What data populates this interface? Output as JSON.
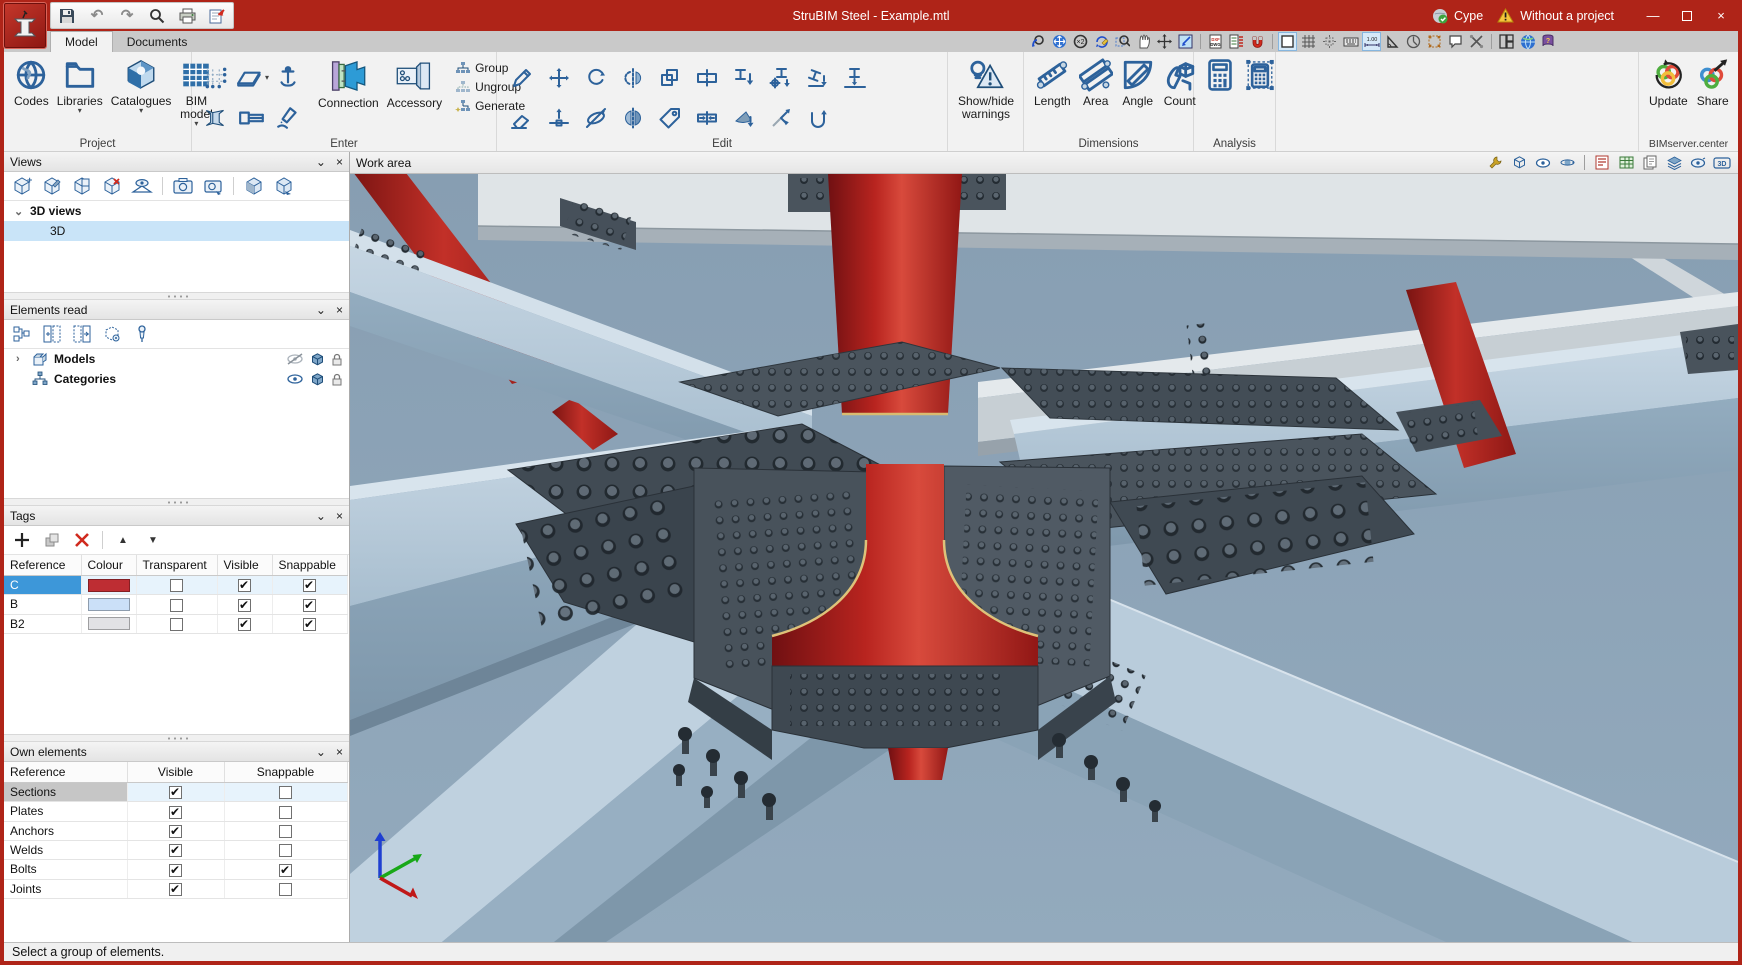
{
  "window": {
    "title": "StruBIM Steel - Example.mtl",
    "account_label": "Cype",
    "warning_label": "Without a project",
    "minimize_glyph": "—",
    "close_glyph": "×"
  },
  "quick_access": {
    "undo_glyph": "↶",
    "redo_glyph": "↷"
  },
  "tabs": {
    "model": "Model",
    "documents": "Documents"
  },
  "ribbon": {
    "project": {
      "label": "Project",
      "codes": "Codes",
      "libraries": "Libraries",
      "catalogues": "Catalogues",
      "bim_model": "BIM\nmodel"
    },
    "enter": {
      "label": "Enter",
      "connection": "Connection",
      "accessory": "Accessory",
      "group": "Group",
      "ungroup": "Ungroup",
      "generate": "Generate"
    },
    "edit": {
      "label": "Edit"
    },
    "warnings": {
      "label_line1": "Show/hide",
      "label_line2": "warnings"
    },
    "dimensions": {
      "label": "Dimensions",
      "length": "Length",
      "area": "Area",
      "angle": "Angle",
      "count": "Count"
    },
    "analysis": {
      "label": "Analysis"
    },
    "bimserver": {
      "label": "BIMserver.center",
      "update": "Update",
      "share": "Share"
    }
  },
  "work_area": {
    "label": "Work area",
    "viewport_3d_badge": "3D"
  },
  "overlays": {
    "zoom_x2": "×2",
    "dim_toggle": "1.00"
  },
  "views_panel": {
    "title": "Views",
    "tree_group": "3D views",
    "view_item": "3D"
  },
  "elements_panel": {
    "title": "Elements read",
    "rows": [
      {
        "label": "Models"
      },
      {
        "label": "Categories"
      }
    ]
  },
  "tags_panel": {
    "title": "Tags",
    "columns": [
      "Reference",
      "Colour",
      "Transparent",
      "Visible",
      "Snappable"
    ],
    "rows": [
      {
        "reference": "C",
        "colour": "#BE2D33",
        "transparent": false,
        "visible": true,
        "snappable": true,
        "selected": true
      },
      {
        "reference": "B",
        "colour": "#CBE0F8",
        "transparent": false,
        "visible": true,
        "snappable": true
      },
      {
        "reference": "B2",
        "colour": "#E2E2E5",
        "transparent": false,
        "visible": true,
        "snappable": true
      }
    ]
  },
  "own_elements_panel": {
    "title": "Own elements",
    "columns": [
      "Reference",
      "Visible",
      "Snappable"
    ],
    "rows": [
      {
        "reference": "Sections",
        "visible": true,
        "snappable": false,
        "selected": true
      },
      {
        "reference": "Plates",
        "visible": true,
        "snappable": false
      },
      {
        "reference": "Anchors",
        "visible": true,
        "snappable": false
      },
      {
        "reference": "Welds",
        "visible": true,
        "snappable": false
      },
      {
        "reference": "Bolts",
        "visible": true,
        "snappable": true
      },
      {
        "reference": "Joints",
        "visible": true,
        "snappable": false
      }
    ]
  },
  "status_bar": {
    "message": "Select a group of elements."
  },
  "colors": {
    "title_red": "#AF2418",
    "selection_blue": "#3D97D9",
    "viewport_bg": "#8CA3B6",
    "ribbon_icon_blue": "#2D629B",
    "column_red": "#C0291F",
    "plate_dark": "#48525B"
  }
}
